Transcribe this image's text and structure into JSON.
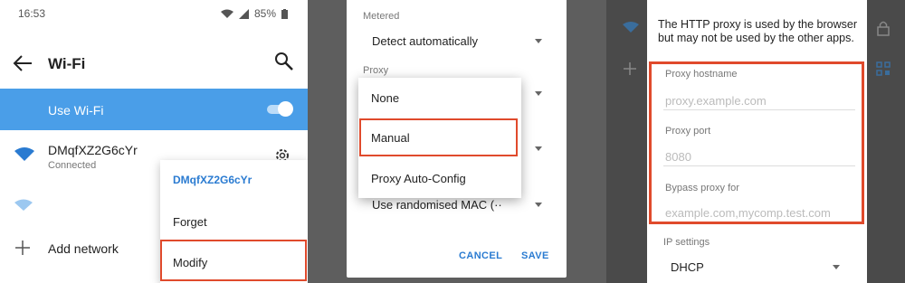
{
  "status": {
    "time": "16:53",
    "battery": "85%"
  },
  "panel1": {
    "title": "Wi-Fi",
    "use_wifi_label": "Use Wi-Fi",
    "network": {
      "name": "DMqfXZ2G6cYr",
      "status": "Connected"
    },
    "add_network_label": "Add network",
    "menu": {
      "title": "DMqfXZ2G6cYr",
      "forget": "Forget",
      "modify": "Modify"
    }
  },
  "panel2": {
    "metered_label": "Metered",
    "metered_value": "Detect automatically",
    "proxy_label": "Proxy",
    "proxy_options": [
      "None",
      "Manual",
      "Proxy Auto-Config"
    ],
    "privacy_value": "Use randomised MAC (··",
    "cancel_label": "CANCEL",
    "save_label": "SAVE"
  },
  "panel3": {
    "info_text": "The HTTP proxy is used by the browser but may not be used by the other apps.",
    "hostname_label": "Proxy hostname",
    "hostname_placeholder": "proxy.example.com",
    "port_label": "Proxy port",
    "port_placeholder": "8080",
    "bypass_label": "Bypass proxy for",
    "bypass_placeholder": "example.com,mycomp.test.com",
    "ip_settings_label": "IP settings",
    "ip_settings_value": "DHCP"
  },
  "colors": {
    "accent": "#4a9ee8",
    "highlight_border": "#e04a2c",
    "link_blue": "#2a7bd1"
  },
  "icons": [
    "back-arrow-icon",
    "search-icon",
    "wifi-icon",
    "gear-icon",
    "plus-icon",
    "wifi-signal-icon",
    "battery-icon",
    "lock-icon",
    "qr-icon"
  ]
}
